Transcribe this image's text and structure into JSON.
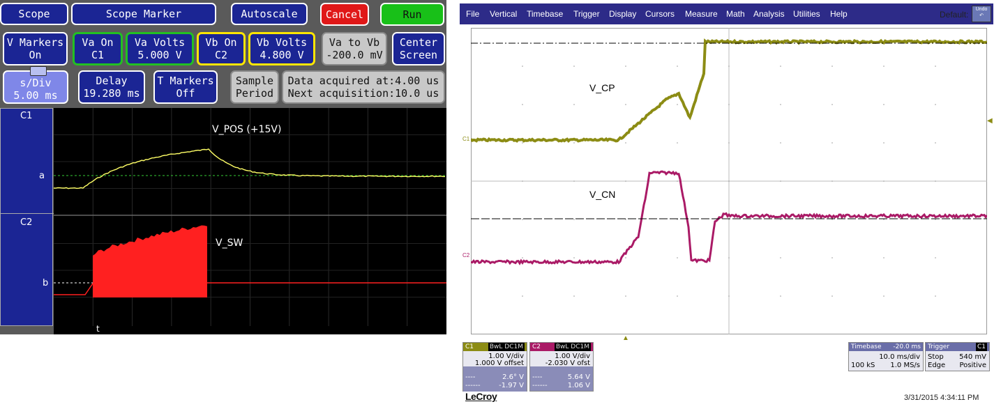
{
  "left": {
    "buttons": {
      "scope": "Scope",
      "scope_marker": "Scope Marker",
      "autoscale": "Autoscale",
      "cancel": "Cancel",
      "run": "Run",
      "v_markers": [
        "V Markers",
        "On"
      ],
      "va_on": [
        "Va On",
        "C1"
      ],
      "va_volts": [
        "Va Volts",
        "5.000  V"
      ],
      "vb_on": [
        "Vb On",
        "C2"
      ],
      "vb_volts": [
        "Vb Volts",
        "4.800  V"
      ],
      "va_to_vb": [
        "Va to Vb",
        "-200.0 mV"
      ],
      "center_screen": [
        "Center",
        "Screen"
      ],
      "s_div": [
        "s/Div",
        "5.00 ms"
      ],
      "delay": [
        "Delay",
        "19.280 ms"
      ],
      "t_markers": [
        "T Markers",
        "Off"
      ],
      "sample_period": [
        "Sample",
        "Period"
      ],
      "acquisition": [
        "Data acquired at:4.00 us",
        "Next acquisition:10.0 us"
      ]
    },
    "channels": {
      "c1": "C1",
      "c2": "C2",
      "marker_a": "a",
      "marker_b": "b",
      "time_marker": "t"
    },
    "traces": {
      "ch1_label": "V_POS (+15V)",
      "ch2_label": "V_SW"
    },
    "colors": {
      "ch1": "#ffff66",
      "ch2": "#ff2020",
      "marker_a": "#33cc33",
      "marker_b": "#ffffff"
    }
  },
  "right": {
    "menu": [
      "File",
      "Vertical",
      "Timebase",
      "Trigger",
      "Display",
      "Cursors",
      "Measure",
      "Math",
      "Analysis",
      "Utilities",
      "Help"
    ],
    "default_label": "Default",
    "undo_label": "Undo",
    "traces": {
      "ch1_label": "V_CP",
      "ch2_label": "V_CN",
      "ch1_marker": "C1",
      "ch2_marker": "C2"
    },
    "colors": {
      "ch1": "#8c8c14",
      "ch2": "#aa1a66"
    },
    "c1_box": {
      "title": "C1",
      "tags": "BwL DC1M",
      "vdiv": "1.00 V/div",
      "offset": "1.000 V offset",
      "cursor1": "2.6° V",
      "cursor2": "-1.97 V"
    },
    "c2_box": {
      "title": "C2",
      "tags": "BwL DC1M",
      "vdiv": "1.00 V/div",
      "offset": "-2.030 V ofst",
      "cursor1": "5.64 V",
      "cursor2": "1.06 V"
    },
    "timebase_box": {
      "title": "Timebase",
      "delay": "-20.0 ms",
      "tdiv": "10.0 ms/div",
      "samples": "100 kS",
      "rate": "1.0 MS/s"
    },
    "trigger_box": {
      "title": "Trigger",
      "channel": "C1",
      "mode": "Stop",
      "level": "540 mV",
      "type": "Edge",
      "slope": "Positive"
    },
    "brand": "LeCroy",
    "datetime": "3/31/2015 4:34:11 PM"
  }
}
